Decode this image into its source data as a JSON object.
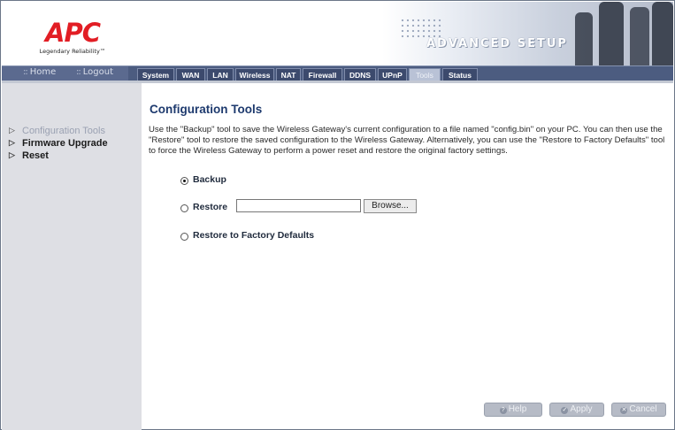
{
  "brand": {
    "logo": "APC",
    "tagline": "Legendary Reliability™",
    "banner": "ADVANCED SETUP"
  },
  "nav": {
    "home": "Home",
    "logout": "Logout",
    "tabs": [
      "System",
      "WAN",
      "LAN",
      "Wireless",
      "NAT",
      "Firewall",
      "DDNS",
      "UPnP",
      "Tools",
      "Status"
    ],
    "active_tab": "Tools"
  },
  "sidebar": {
    "items": [
      {
        "label": "Configuration Tools"
      },
      {
        "label": "Firmware Upgrade"
      },
      {
        "label": "Reset"
      }
    ]
  },
  "main": {
    "title": "Configuration Tools",
    "description": "Use the \"Backup\" tool to save the Wireless Gateway's current configuration to a file named \"config.bin\" on your PC. You can then use the \"Restore\" tool to restore the saved configuration to the Wireless Gateway.  Alternatively, you can use the \"Restore to Factory Defaults\" tool to force the Wireless Gateway to perform a power reset and restore the original factory settings.",
    "options": {
      "backup": "Backup",
      "restore": "Restore",
      "factory": "Restore to Factory Defaults",
      "selected": "Backup"
    },
    "file_value": "",
    "browse": "Browse..."
  },
  "buttons": {
    "help": "Help",
    "apply": "Apply",
    "cancel": "Cancel"
  }
}
